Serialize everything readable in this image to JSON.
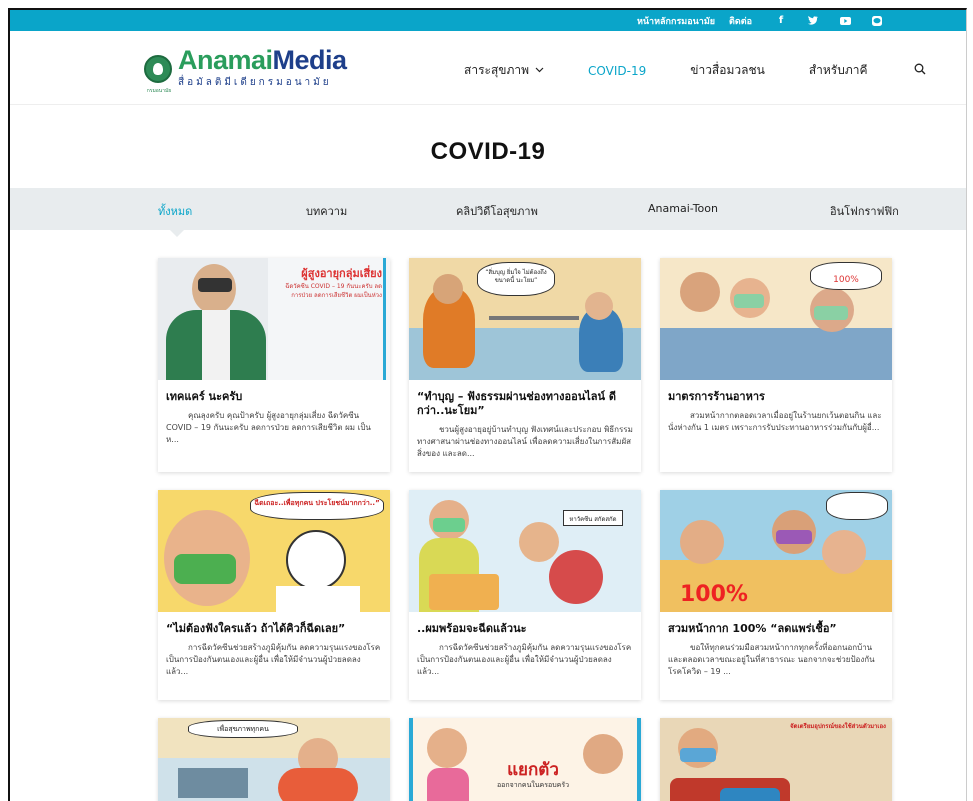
{
  "topbar": {
    "home_link": "หน้าหลักกรมอนามัย",
    "contact_link": "ติดต่อ",
    "social_icons": [
      "facebook-icon",
      "twitter-icon",
      "youtube-icon",
      "line-icon"
    ]
  },
  "logo": {
    "brand_a": "Anamai",
    "brand_b": "Media",
    "tagline": "สื่อมัลติมีเดียกรมอนามัย",
    "emblem_caption": "กรมอนามัย"
  },
  "nav": {
    "items": [
      {
        "label": "สาระสุขภาพ",
        "has_dropdown": true
      },
      {
        "label": "COVID-19",
        "active": true
      },
      {
        "label": "ข่าวสื่อมวลชน"
      },
      {
        "label": "สำหรับภาคี"
      }
    ],
    "search_icon": "search-icon"
  },
  "page": {
    "title": "COVID-19"
  },
  "tabs": [
    {
      "label": "ทั้งหมด",
      "active": true
    },
    {
      "label": "บทความ"
    },
    {
      "label": "คลิปวิดีโอสุขภาพ"
    },
    {
      "label": "Anamai-Toon"
    },
    {
      "label": "อินโฟกราฟฟิก"
    }
  ],
  "cards": [
    {
      "title": "เทคแคร์ นะครับ",
      "excerpt": "คุณลุงครับ คุณป้าครับ ผู้สูงอายุกลุ่มเสี่ยง ฉีดวัคซีน COVID – 19 กันนะครับ ลดการป่วย ลดการเสียชีวิต ผม เป็นห...",
      "image_caption_1": "ผู้สูงอายุกลุ่มเสี่ยง",
      "image_caption_2": "ฉีดวัคซีน COVID – 19 กันนะครับ ลดการป่วย ลดการเสียชีวิต ผมเป็นห่วง"
    },
    {
      "title": "“ทำบุญ – ฟังธรรมผ่านช่องทางออนไลน์ ดีกว่า..นะโยม”",
      "excerpt": "ชวนผู้สูงอายุอยู่บ้านทำบุญ ฟังเทศน์และประกอบ พิธีกรรมทางศาสนาผ่านช่องทางออนไลน์ เพื่อลดความเสี่ยงในการสัมผัสสิ่งของ และลด...",
      "image_caption_1": "“สิ่มบุญ ยิ่มใจ ไม่ต้องถึงขนาดนี้ นะโยม”"
    },
    {
      "title": "มาตรการร้านอาหาร",
      "excerpt": "สวมหน้ากากตลอดเวลาเมื่ออยู่ในร้านยกเว้นตอนกิน และนั่งห่างกัน 1 เมตร เพราะการรับประทานอาหารร่วมกันกับผู้อื่...",
      "image_caption_1": "100%"
    },
    {
      "title": "“ไม่ต้องฟังใครแล้ว ถ้าได้คิวก็ฉีดเลย”",
      "excerpt": "การฉีดวัคซีนช่วยสร้างภูมิคุ้มกัน ลดความรุนแรงของโรค เป็นการป้องกันตนเองและผู้อื่น เพื่อให้มีจำนวนผู้ป่วยลดลง แล้ว...",
      "image_caption_1": "ฉีดเถอะ..เพื่อทุกคน ประโยชน์มากกว่า..”"
    },
    {
      "title": "..ผมพร้อมจะฉีดแล้วนะ",
      "excerpt": "การฉีดวัคซีนช่วยสร้างภูมิคุ้มกัน ลดความรุนแรงของโรค เป็นการป้องกันตนเองและผู้อื่น เพื่อให้มีจำนวนผู้ป่วยลดลง แล้ว...",
      "image_caption_1": "หาวัคซีน สกัดสกัด"
    },
    {
      "title": "สวมหน้ากาก 100% “ลดแพร่เชื้อ”",
      "excerpt": "ขอให้ทุกคนร่วมมือสวมหน้ากากทุกครั้งที่ออกนอกบ้าน และตลอดเวลาขณะอยู่ในที่สาธารณะ นอกจากจะช่วยป้องกันโรคโควิด – 19 ...",
      "image_caption_1": "100%"
    },
    {
      "title": "",
      "excerpt": "",
      "image_caption_1": "เพื่อสุขภาพทุกคน"
    },
    {
      "title": "",
      "excerpt": "",
      "image_caption_1": "แยกตัว",
      "image_caption_2": "ออกจากคนในครอบครัว"
    },
    {
      "title": "",
      "excerpt": "",
      "image_caption_1": "จัดเตรียมอุปกรณ์ของใช้ส่วนตัวมาเอง"
    }
  ],
  "colors": {
    "accent": "#0aa5c9",
    "brand_green": "#2a9d5c",
    "brand_blue": "#1e3f8a",
    "tabbar_bg": "#e8ecee"
  }
}
